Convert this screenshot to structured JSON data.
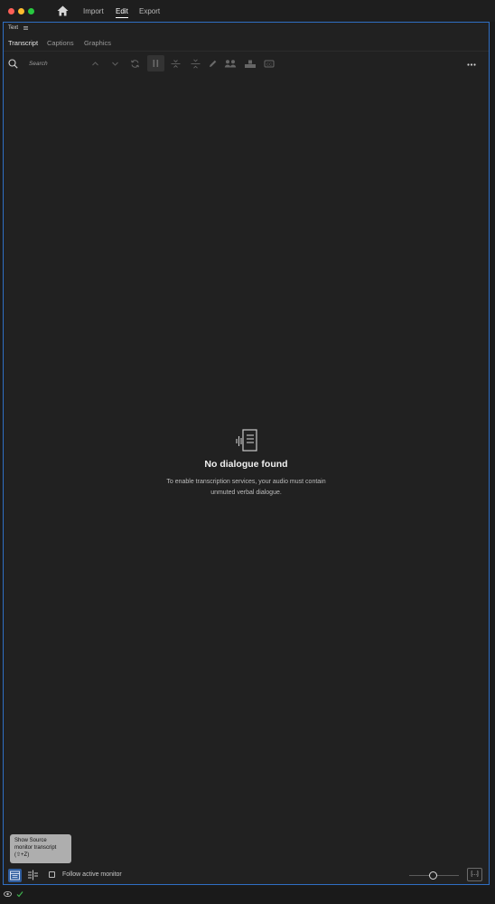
{
  "nav": {
    "import": "Import",
    "edit": "Edit",
    "export": "Export"
  },
  "panel": {
    "title": "Text"
  },
  "tabs": [
    "Transcript",
    "Captions",
    "Graphics"
  ],
  "search": {
    "placeholder": "Search"
  },
  "toolbar": {
    "icons": [
      "chevron-up-icon",
      "chevron-down-icon",
      "sync-icon",
      "pause-icon",
      "split-icon",
      "merge-icon",
      "pencil-icon",
      "speakers-icon",
      "insert-icon",
      "caption-icon",
      "more-icon"
    ]
  },
  "empty_state": {
    "title": "No dialogue found",
    "description_line1": "To enable transcription services, your audio must contain",
    "description_line2": "unmuted verbal dialogue."
  },
  "tooltip": {
    "line1": "Show Source",
    "line2": "monitor transcript",
    "line3": "(⇧+Z)"
  },
  "footer": {
    "follow_label": "Follow active monitor",
    "fit_label": "[...]"
  },
  "colors": {
    "accent": "#2f6fc4",
    "panel_bg": "#212121",
    "app_bg": "#1b1b1b"
  }
}
